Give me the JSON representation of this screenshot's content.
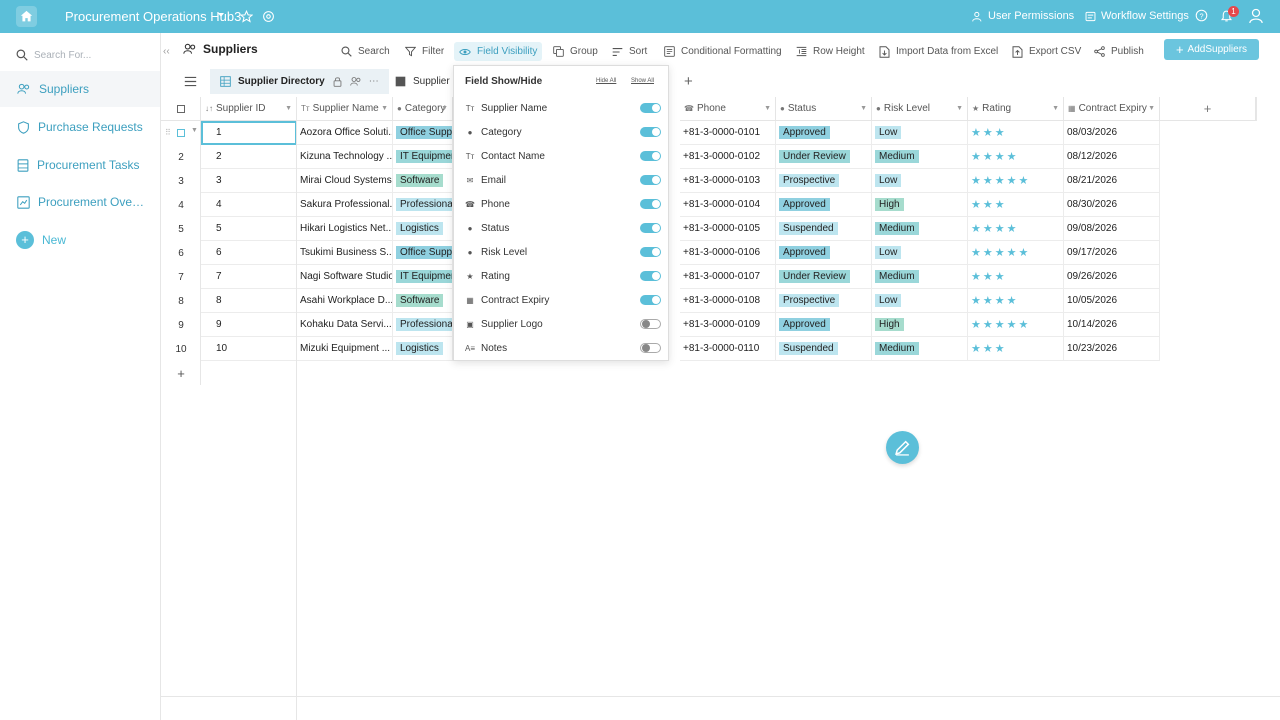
{
  "topbar": {
    "app_title": "Procurement Operations Hub3",
    "user_permissions": "User Permissions",
    "workflow_settings": "Workflow Settings",
    "notification_count": "1"
  },
  "sidebar": {
    "search_placeholder": "Search For...",
    "items": [
      {
        "label": "Suppliers",
        "icon": "group-icon"
      },
      {
        "label": "Purchase Requests",
        "icon": "shield-icon"
      },
      {
        "label": "Procurement Tasks",
        "icon": "grid-icon"
      },
      {
        "label": "Procurement Overvi...",
        "icon": "dashboard-icon"
      }
    ],
    "new_label": "New"
  },
  "table_title": "Suppliers",
  "toolbar": {
    "search": "Search",
    "filter": "Filter",
    "field_visibility": "Field Visibility",
    "group": "Group",
    "sort": "Sort",
    "conditional_formatting": "Conditional Formatting",
    "row_height": "Row Height",
    "import": "Import Data from Excel",
    "export": "Export CSV",
    "publish": "Publish",
    "add": "AddSuppliers"
  },
  "views": {
    "active": "Supplier Directory",
    "second": "Supplier C"
  },
  "columns": {
    "supplier_id": "Supplier ID",
    "supplier_name": "Supplier Name",
    "category": "Category",
    "phone": "Phone",
    "status": "Status",
    "risk_level": "Risk Level",
    "rating": "Rating",
    "contract_expiry": "Contract Expiry"
  },
  "rows": [
    {
      "n": "1",
      "id": "1",
      "name": "Aozora Office Soluti...",
      "category": "Office Suppli",
      "phone": "+81-3-0000-0101",
      "status": "Approved",
      "risk": "Low",
      "rating": 3,
      "expiry": "08/03/2026"
    },
    {
      "n": "2",
      "id": "2",
      "name": "Kizuna Technology ...",
      "category": "IT Equipmen",
      "phone": "+81-3-0000-0102",
      "status": "Under Review",
      "risk": "Medium",
      "rating": 4,
      "expiry": "08/12/2026"
    },
    {
      "n": "3",
      "id": "3",
      "name": "Mirai Cloud Systems",
      "category": "Software",
      "phone": "+81-3-0000-0103",
      "status": "Prospective",
      "risk": "Low",
      "rating": 5,
      "expiry": "08/21/2026"
    },
    {
      "n": "4",
      "id": "4",
      "name": "Sakura Professional...",
      "category": "Professional",
      "phone": "+81-3-0000-0104",
      "status": "Approved",
      "risk": "High",
      "rating": 3,
      "expiry": "08/30/2026"
    },
    {
      "n": "5",
      "id": "5",
      "name": "Hikari Logistics Net...",
      "category": "Logistics",
      "phone": "+81-3-0000-0105",
      "status": "Suspended",
      "risk": "Medium",
      "rating": 4,
      "expiry": "09/08/2026"
    },
    {
      "n": "6",
      "id": "6",
      "name": "Tsukimi Business S...",
      "category": "Office Suppli",
      "phone": "+81-3-0000-0106",
      "status": "Approved",
      "risk": "Low",
      "rating": 5,
      "expiry": "09/17/2026"
    },
    {
      "n": "7",
      "id": "7",
      "name": "Nagi Software Studio",
      "category": "IT Equipmen",
      "phone": "+81-3-0000-0107",
      "status": "Under Review",
      "risk": "Medium",
      "rating": 3,
      "expiry": "09/26/2026"
    },
    {
      "n": "8",
      "id": "8",
      "name": "Asahi Workplace D...",
      "category": "Software",
      "phone": "+81-3-0000-0108",
      "status": "Prospective",
      "risk": "Low",
      "rating": 4,
      "expiry": "10/05/2026"
    },
    {
      "n": "9",
      "id": "9",
      "name": "Kohaku Data Servi...",
      "category": "Professional",
      "phone": "+81-3-0000-0109",
      "status": "Approved",
      "risk": "High",
      "rating": 5,
      "expiry": "10/14/2026"
    },
    {
      "n": "10",
      "id": "10",
      "name": "Mizuki Equipment ...",
      "category": "Logistics",
      "phone": "+81-3-0000-0110",
      "status": "Suspended",
      "risk": "Medium",
      "rating": 3,
      "expiry": "10/23/2026"
    }
  ],
  "popup": {
    "title": "Field Show/Hide",
    "hide_all": "Hide All",
    "show_all": "Show All",
    "fields": [
      {
        "label": "Supplier Name",
        "icon": "text-icon",
        "glyph": "Tт",
        "on": true
      },
      {
        "label": "Category",
        "icon": "select-icon",
        "glyph": "●",
        "on": true
      },
      {
        "label": "Contact Name",
        "icon": "text-icon",
        "glyph": "Tт",
        "on": true
      },
      {
        "label": "Email",
        "icon": "email-icon",
        "glyph": "✉",
        "on": true
      },
      {
        "label": "Phone",
        "icon": "phone-icon",
        "glyph": "☎",
        "on": true
      },
      {
        "label": "Status",
        "icon": "select-icon",
        "glyph": "●",
        "on": true
      },
      {
        "label": "Risk Level",
        "icon": "select-icon",
        "glyph": "●",
        "on": true
      },
      {
        "label": "Rating",
        "icon": "star-icon",
        "glyph": "★",
        "on": true
      },
      {
        "label": "Contract Expiry",
        "icon": "calendar-icon",
        "glyph": "▦",
        "on": true
      },
      {
        "label": "Supplier Logo",
        "icon": "image-icon",
        "glyph": "▣",
        "on": false
      },
      {
        "label": "Notes",
        "icon": "notes-icon",
        "glyph": "A≡",
        "on": false
      }
    ]
  },
  "colors": {
    "accent": "#5bbfd9",
    "link": "#3c9fbf"
  }
}
